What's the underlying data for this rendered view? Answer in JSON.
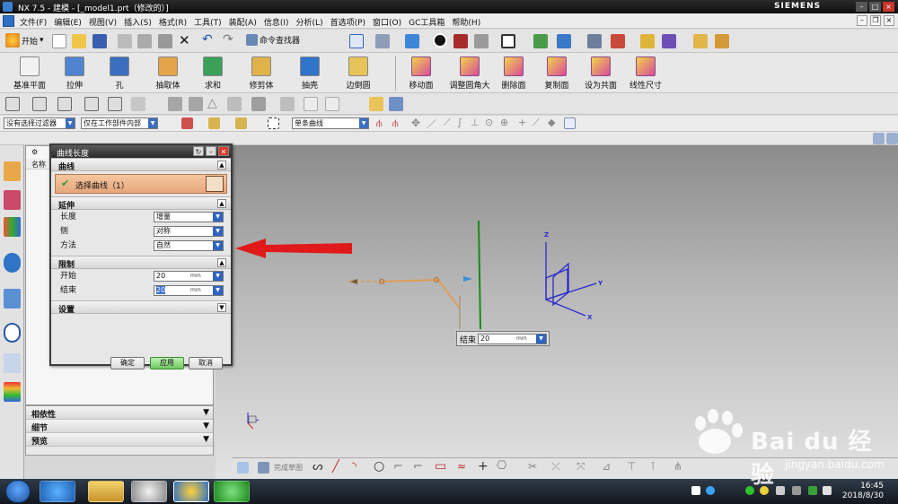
{
  "window": {
    "title": "NX 7.5 - 建模 - [_model1.prt（修改的）]",
    "brand": "SIEMENS"
  },
  "menu": {
    "items": [
      "文件(F)",
      "编辑(E)",
      "视图(V)",
      "插入(S)",
      "格式(R)",
      "工具(T)",
      "装配(A)",
      "信息(I)",
      "分析(L)",
      "首选项(P)",
      "窗口(O)",
      "GC工具箱",
      "帮助(H)"
    ]
  },
  "standard_toolbar": {
    "start_label": "开始",
    "command_finder_label": "命令查找器"
  },
  "feature_toolbar": {
    "buttons": [
      "基准平面",
      "拉伸",
      "孔",
      "抽取体",
      "求和",
      "修剪体",
      "抽壳",
      "边倒圆"
    ],
    "sync_buttons": [
      "移动面",
      "调整圆角大小",
      "删除面",
      "复制面",
      "设为共面",
      "线性尺寸"
    ]
  },
  "selection_bar": {
    "filter": "没有选择过滤器",
    "scope": "仅在工作部件内部",
    "curve_rule": "单条曲线"
  },
  "navigator": {
    "column_header": "名称",
    "bottom_sections": [
      "相依性",
      "细节",
      "预览"
    ]
  },
  "dialog": {
    "title": "曲线长度",
    "sections": {
      "curve": "曲线",
      "extend": "延伸",
      "limits": "限制",
      "settings": "设置"
    },
    "select_curve_label": "选择曲线（1）",
    "length_label": "长度",
    "length_value": "增量",
    "side_label": "侧",
    "side_value": "对称",
    "method_label": "方法",
    "method_value": "自然",
    "start_label": "开始",
    "start_value": "20",
    "end_label": "结束",
    "end_value": "20",
    "unit": "mm",
    "ok": "确定",
    "apply": "应用",
    "cancel": "取消"
  },
  "canvas": {
    "end_float_label": "结束",
    "end_float_value": "20",
    "end_float_unit": "mm",
    "axis_x": "X",
    "axis_y": "Y",
    "axis_z": "Z"
  },
  "sketch_toolbar": {
    "finish_sketch": "完成草图"
  },
  "taskbar": {
    "time": "16:45",
    "date": "2018/8/30"
  },
  "watermark": {
    "brand": "Bai du 经验",
    "url": "jingyan.baidu.com"
  },
  "colors": {
    "accent_blue": "#2f64c0",
    "dialog_title": "#3a3a3a",
    "selected_curve": "#e6a67a",
    "curve_orange": "#e39a4b",
    "axis_green": "#1a8a1a",
    "triad_blue": "#2a2ad0",
    "arrow_red": "#e01a1a"
  }
}
